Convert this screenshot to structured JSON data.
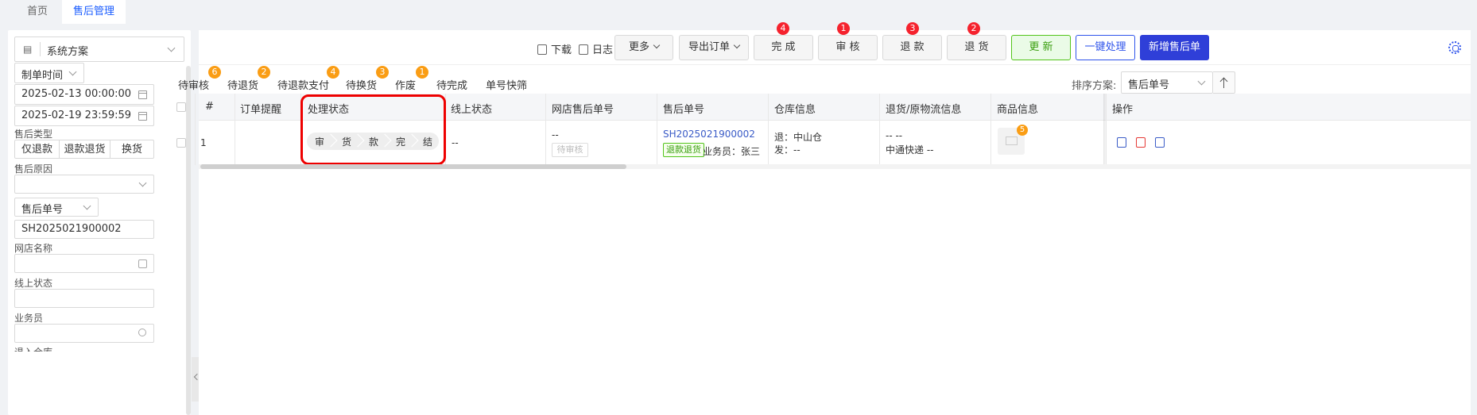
{
  "top_tabs": [
    {
      "label": "首页"
    },
    {
      "label": "售后管理"
    }
  ],
  "sidebar": {
    "scheme_label": "系统方案",
    "date_type": "制单时间",
    "date_start": "2025-02-13 00:00:00",
    "date_end": "2025-02-19 23:59:59",
    "aftersale_type_label": "售后类型",
    "aftersale_types": [
      "仅退款",
      "退款退货",
      "换货"
    ],
    "reason_label": "售后原因",
    "reason_value": "",
    "number_type": "售后单号",
    "number_value": "SH2025021900002",
    "shop_label": "网店名称",
    "shop_value": "",
    "online_status_label": "线上状态",
    "online_status_value": "",
    "salesperson_label": "业务员",
    "salesperson_value": "",
    "truncated_label": "退入仓库"
  },
  "toolbar": {
    "download": "下载",
    "log": "日志",
    "more": "更多",
    "export": "导出订单",
    "complete": "完 成",
    "complete_badge": "4",
    "review": "审 核",
    "review_badge": "1",
    "refund": "退 款",
    "refund_badge": "3",
    "return": "退 货",
    "return_badge": "2",
    "refresh": "更 新",
    "one_click": "一键处理",
    "add_new": "新增售后单"
  },
  "status_tabs": [
    {
      "label": "待审核",
      "badge": "6"
    },
    {
      "label": "待退货",
      "badge": "2"
    },
    {
      "label": "待退款支付",
      "badge": "4"
    },
    {
      "label": "待换货",
      "badge": "3"
    },
    {
      "label": "作废",
      "badge": "1"
    },
    {
      "label": "待完成",
      "badge": ""
    },
    {
      "label": "单号快筛",
      "badge": ""
    }
  ],
  "sort": {
    "label": "排序方案:",
    "value": "售后单号"
  },
  "table": {
    "headers": [
      "#",
      "订单提醒",
      "处理状态",
      "线上状态",
      "网店售后单号",
      "售后单号",
      "仓库信息",
      "退货/原物流信息",
      "商品信息",
      "操作"
    ],
    "rows": [
      {
        "index": "1",
        "reminder": "",
        "steps": [
          "审",
          "货",
          "款",
          "完",
          "结"
        ],
        "online_status": "--",
        "shop_aftersale_no": "--",
        "shop_aftersale_badge": "待审核",
        "aftersale_no": "SH2025021900002",
        "type_tag": "退款退货",
        "salesperson": "业务员：张三",
        "warehouse_return": "退：中山仓",
        "warehouse_ship": "发：--",
        "logistics_1": "-- --",
        "logistics_2": "中通快递 --",
        "goods_badge": "5"
      }
    ]
  },
  "colors": {
    "primary": "#2f3fd8",
    "badge_red": "#f5222d",
    "badge_orange": "#fa9d14",
    "highlight": "#e00000",
    "success": "#52c41a"
  }
}
